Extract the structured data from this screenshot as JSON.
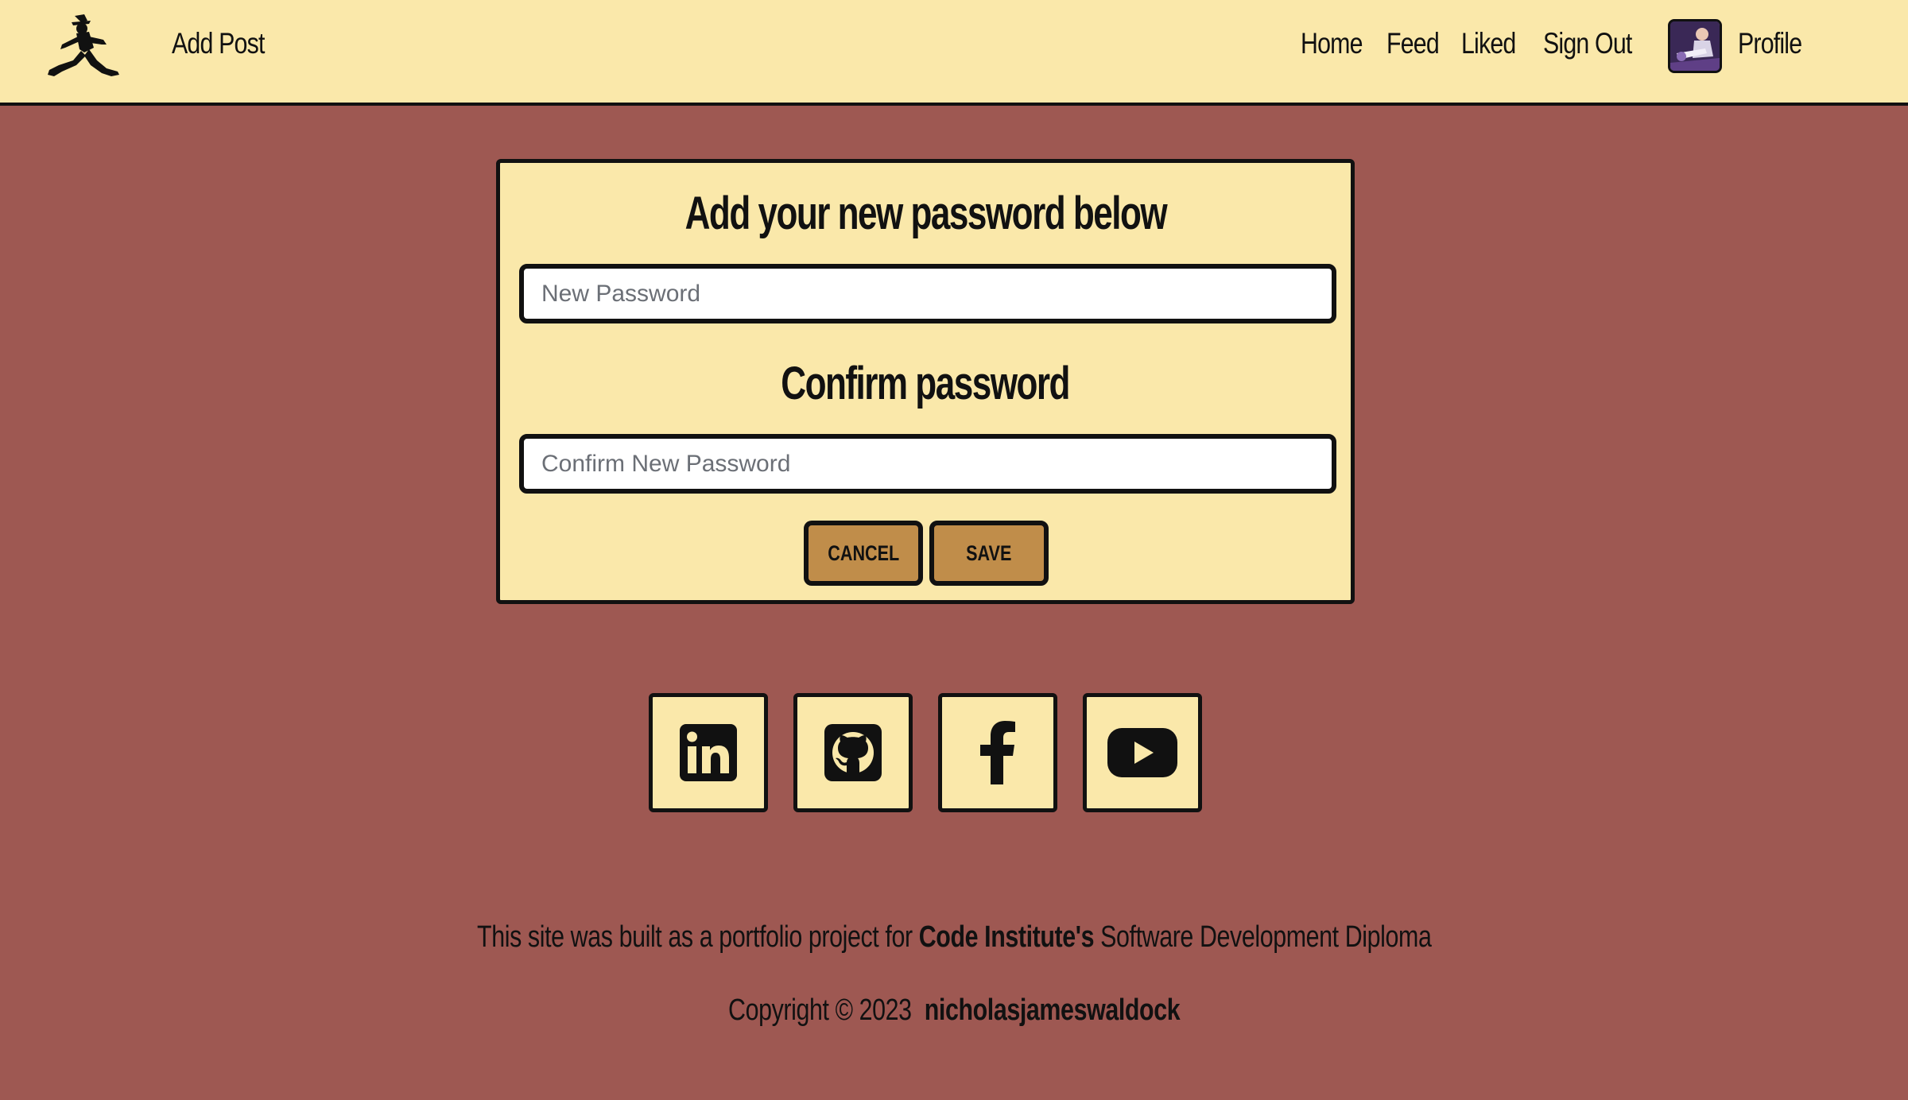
{
  "navbar": {
    "logo_icon": "running-man-logo-icon",
    "add_post": "Add Post",
    "links": [
      {
        "label": "Home"
      },
      {
        "label": "Feed"
      },
      {
        "label": "Liked"
      },
      {
        "label": "Sign Out"
      }
    ],
    "profile": {
      "label": "Profile",
      "avatar_icon": "profile-avatar"
    }
  },
  "form": {
    "new_password_heading": "Add your new password below",
    "new_password_placeholder": "New Password",
    "confirm_heading": "Confirm password",
    "confirm_placeholder": "Confirm New Password",
    "cancel_label": "CANCEL",
    "save_label": "SAVE"
  },
  "social": [
    {
      "name": "linkedin",
      "icon": "linkedin-icon"
    },
    {
      "name": "github",
      "icon": "github-icon"
    },
    {
      "name": "facebook",
      "icon": "facebook-icon"
    },
    {
      "name": "youtube",
      "icon": "youtube-icon"
    }
  ],
  "footer": {
    "line1_pre": "This site was built as a portfolio project for",
    "line1_bold": "Code Institute's",
    "line1_post": "Software Development Diploma",
    "copyright": "Copyright © 2023",
    "author": "nicholasjameswaldock"
  },
  "colors": {
    "page_background": "#9e5852",
    "panel_background": "#fae8aa",
    "button_background": "#c08d4a",
    "border": "#111111"
  }
}
